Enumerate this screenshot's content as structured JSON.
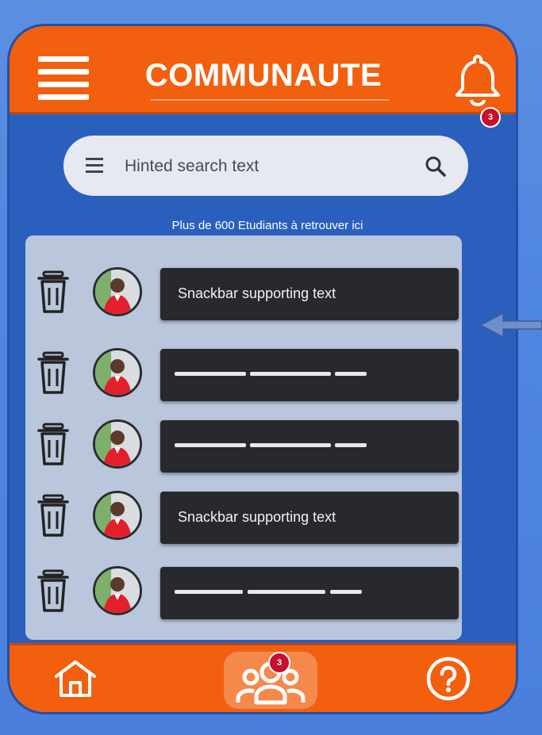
{
  "header": {
    "title": "COMMUNAUTE",
    "notification_count": "3"
  },
  "search": {
    "placeholder": "Hinted search text"
  },
  "subtitle": "Plus de 600 Etudiants à retrouver ici",
  "list": {
    "items": [
      {
        "type": "text",
        "text": "Snackbar supporting text"
      },
      {
        "type": "placeholder"
      },
      {
        "type": "placeholder"
      },
      {
        "type": "text",
        "text": "Snackbar supporting text"
      },
      {
        "type": "placeholder"
      }
    ]
  },
  "bottom_nav": {
    "community_badge": "3"
  },
  "icons": {
    "menu": "hamburger-menu-icon",
    "bell": "bell-icon",
    "search": "search-icon",
    "trash": "trash-icon",
    "home": "home-icon",
    "community": "people-group-icon",
    "help": "help-circle-icon"
  },
  "colors": {
    "accent": "#f2600f",
    "background": "#2b5fbd",
    "badge": "#c8102e",
    "snackbar": "#27292d"
  }
}
